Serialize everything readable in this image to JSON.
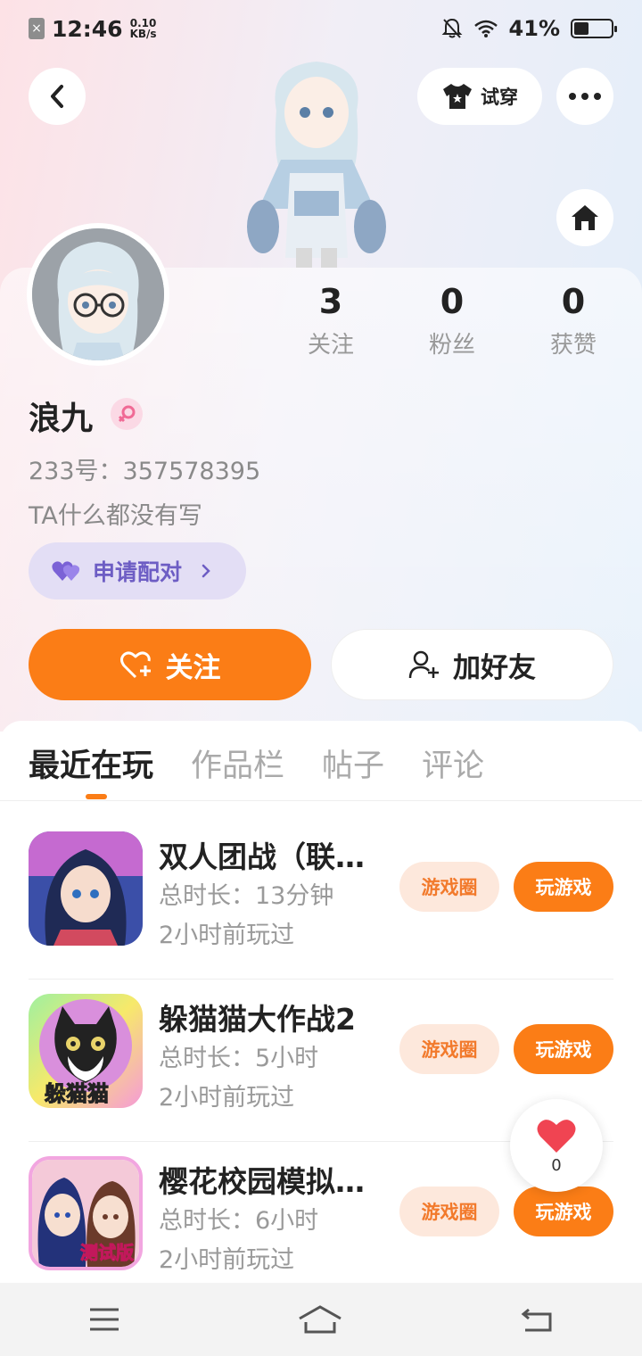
{
  "status_bar": {
    "time": "12:46",
    "speed_value": "0.10",
    "speed_unit": "KB/s",
    "battery": "41%",
    "battery_level": 0.41
  },
  "header": {
    "try_on_label": "试穿"
  },
  "profile": {
    "stats": [
      {
        "value": "3",
        "label": "关注"
      },
      {
        "value": "0",
        "label": "粉丝"
      },
      {
        "value": "0",
        "label": "获赞"
      }
    ],
    "name": "浪九",
    "uid": "233号：357578395",
    "bio": "TA什么都没有写",
    "pair_label": "申请配对",
    "follow_label": "关注",
    "add_friend_label": "加好友"
  },
  "tabs": [
    {
      "label": "最近在玩",
      "active": true
    },
    {
      "label": "作品栏",
      "active": false
    },
    {
      "label": "帖子",
      "active": false
    },
    {
      "label": "评论",
      "active": false
    }
  ],
  "games": [
    {
      "title": "双人团战（联…",
      "duration": "总时长：13分钟",
      "last_played": "2小时前玩过",
      "circle_label": "游戏圈",
      "play_label": "玩游戏"
    },
    {
      "title": "躲猫猫大作战2",
      "duration": "总时长：5小时",
      "last_played": "2小时前玩过",
      "circle_label": "游戏圈",
      "play_label": "玩游戏",
      "icon_text": "躲猫猫"
    },
    {
      "title": "樱花校园模拟…",
      "duration": "总时长：6小时",
      "last_played": "2小时前玩过",
      "circle_label": "游戏圈",
      "play_label": "玩游戏",
      "icon_text": "测试版"
    }
  ],
  "like_float": {
    "count": "0"
  },
  "colors": {
    "accent": "#fb7d16",
    "pair_purple": "#6d5dc4",
    "heart_red": "#f04452"
  }
}
